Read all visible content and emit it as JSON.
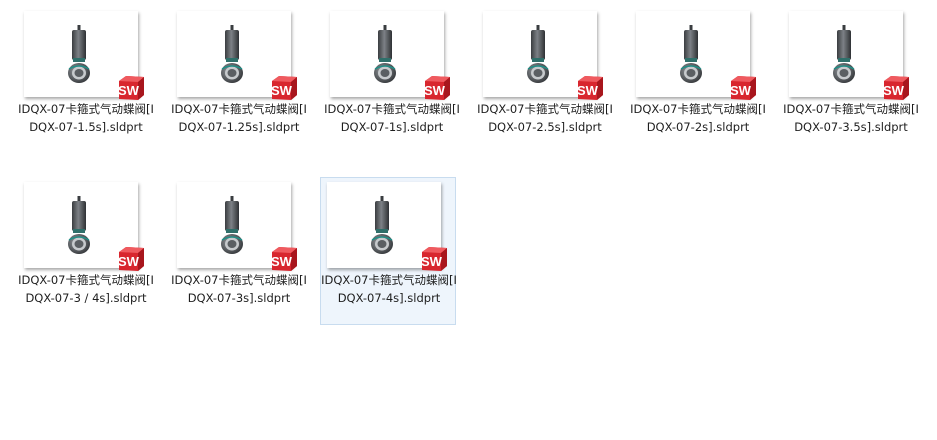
{
  "files": [
    {
      "label": "IDQX-07卡箍式气动蝶阀[IDQX-07-1.5s].sldprt",
      "selected": false,
      "icon": "solidworks-part-icon",
      "badge": "SW"
    },
    {
      "label": "IDQX-07卡箍式气动蝶阀[IDQX-07-1.25s].sldprt",
      "selected": false,
      "icon": "solidworks-part-icon",
      "badge": "SW"
    },
    {
      "label": "IDQX-07卡箍式气动蝶阀[IDQX-07-1s].sldprt",
      "selected": false,
      "icon": "solidworks-part-icon",
      "badge": "SW"
    },
    {
      "label": "IDQX-07卡箍式气动蝶阀[IDQX-07-2.5s].sldprt",
      "selected": false,
      "icon": "solidworks-part-icon",
      "badge": "SW"
    },
    {
      "label": "IDQX-07卡箍式气动蝶阀[IDQX-07-2s].sldprt",
      "selected": false,
      "icon": "solidworks-part-icon",
      "badge": "SW"
    },
    {
      "label": "IDQX-07卡箍式气动蝶阀[IDQX-07-3.5s].sldprt",
      "selected": false,
      "icon": "solidworks-part-icon",
      "badge": "SW"
    },
    {
      "label": "IDQX-07卡箍式气动蝶阀[IDQX-07-3 / 4s].sldprt",
      "selected": false,
      "icon": "solidworks-part-icon",
      "badge": "SW"
    },
    {
      "label": "IDQX-07卡箍式气动蝶阀[IDQX-07-3s].sldprt",
      "selected": false,
      "icon": "solidworks-part-icon",
      "badge": "SW"
    },
    {
      "label": "IDQX-07卡箍式气动蝶阀[IDQX-07-4s].sldprt",
      "selected": true,
      "icon": "solidworks-part-icon",
      "badge": "SW"
    }
  ],
  "colors": {
    "badge_red": "#d8262e",
    "selection_bg": "#eef5fc",
    "selection_border": "#c8dcef"
  }
}
